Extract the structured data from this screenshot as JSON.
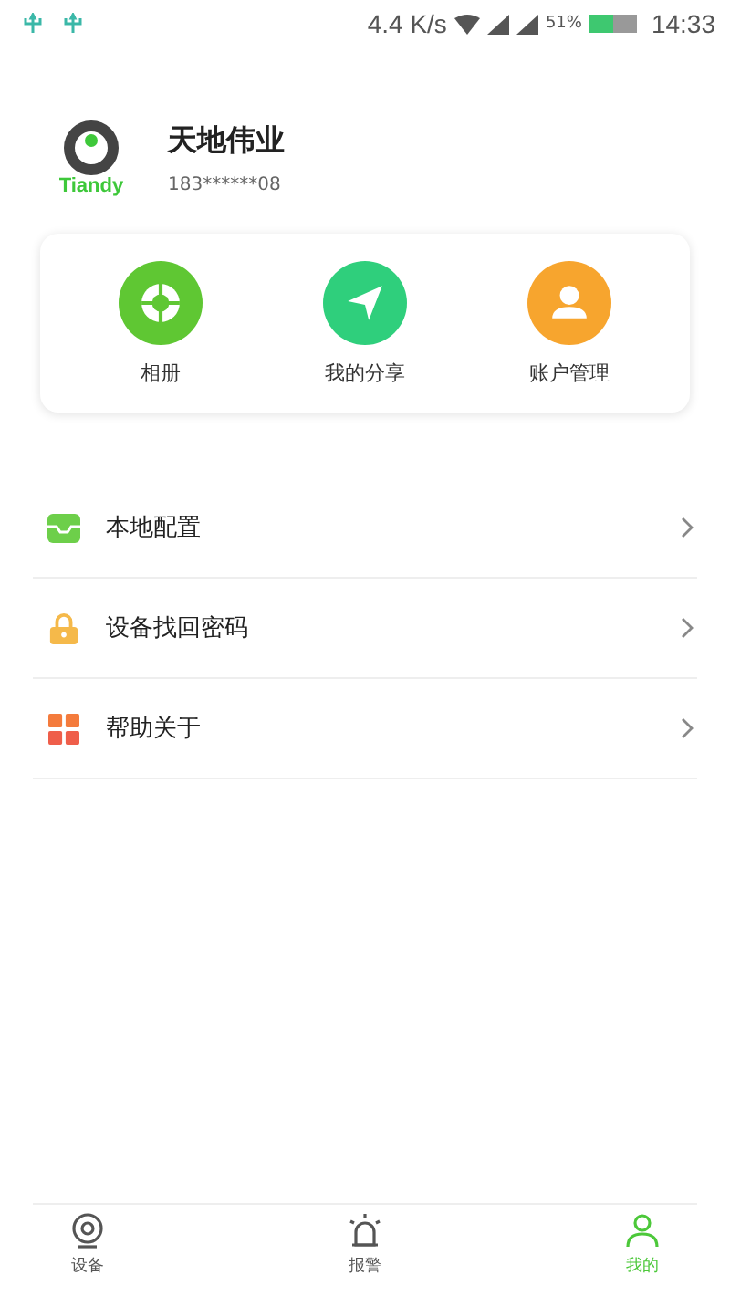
{
  "status_bar": {
    "network_speed": "4.4 K/s",
    "battery_percent": "51%",
    "time": "14:33"
  },
  "profile": {
    "logo_text": "Tiandy",
    "name": "天地伟业",
    "phone": "183******08"
  },
  "shortcuts": [
    {
      "label": "相册",
      "kind": "album"
    },
    {
      "label": "我的分享",
      "kind": "share"
    },
    {
      "label": "账户管理",
      "kind": "account"
    }
  ],
  "menu": [
    {
      "label": "本地配置",
      "kind": "local"
    },
    {
      "label": "设备找回密码",
      "kind": "lock"
    },
    {
      "label": "帮助关于",
      "kind": "help"
    }
  ],
  "tab_bar": [
    {
      "label": "设备",
      "kind": "device",
      "selected": false
    },
    {
      "label": "报警",
      "kind": "alarm",
      "selected": false
    },
    {
      "label": "我的",
      "kind": "me",
      "selected": true
    }
  ]
}
